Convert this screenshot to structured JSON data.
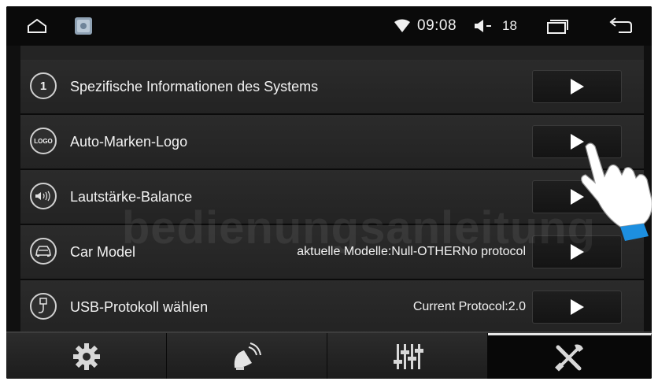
{
  "statusbar": {
    "time": "09:08",
    "volume": "18",
    "icons": [
      "home-icon",
      "gallery-app-icon",
      "wifi-icon",
      "volume-icon",
      "recent-apps-icon",
      "back-icon"
    ]
  },
  "list": {
    "items": [
      {
        "icon": "info-number-icon",
        "icon_text": "1",
        "label": "Spezifische Informationen des Systems",
        "value": ""
      },
      {
        "icon": "logo-icon",
        "icon_text": "LOGO",
        "label": "Auto-Marken-Logo",
        "value": ""
      },
      {
        "icon": "sound-balance-icon",
        "icon_text": "",
        "label": "Lautstärke-Balance",
        "value": ""
      },
      {
        "icon": "car-icon",
        "icon_text": "",
        "label": "Car Model",
        "value": "aktuelle Modelle:Null-OTHERNo protocol"
      },
      {
        "icon": "usb-icon",
        "icon_text": "",
        "label": "USB-Protokoll wählen",
        "value": "Current Protocol:2.0"
      }
    ],
    "button_icon": "play-arrow-icon"
  },
  "watermark": "bedienungsanleitung",
  "bottomnav": {
    "tabs": [
      {
        "icon": "gear-icon",
        "active": false
      },
      {
        "icon": "satellite-dish-icon",
        "active": false
      },
      {
        "icon": "equalizer-icon",
        "active": false
      },
      {
        "icon": "tools-icon",
        "active": true
      }
    ]
  },
  "colors": {
    "screen_bg": "#101010",
    "row_bg": "#262626",
    "text": "#f2f2f2",
    "hand_cuff": "#1d8fe0"
  }
}
